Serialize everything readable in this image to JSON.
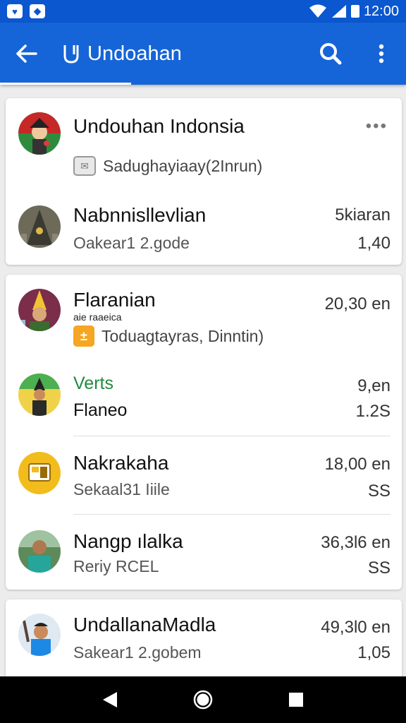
{
  "status_bar": {
    "time": "12:00"
  },
  "app_bar": {
    "title": "Undoahan"
  },
  "cards": [
    {
      "rows": [
        {
          "title": "Undouhan Indonsia",
          "chip": "Sadughayiaay(2Inrun)"
        },
        {
          "title": "Nabnnisllevlian",
          "subtitle": "Oakear1 2.gode",
          "right_top": "5kiaran",
          "right_bottom": "1,40"
        }
      ]
    },
    {
      "rows": [
        {
          "title": "Flaranian",
          "tiny": "aie raaeica",
          "chip": "Toduagtayras, Dinntin)",
          "right_top": "20,30 en"
        },
        {
          "title": "Verts",
          "subtitle": "Flaneo",
          "right_top": "9,en",
          "right_bottom": "1.2S"
        },
        {
          "title": "Nakrakaha",
          "subtitle": "Sekaal31 Iiile",
          "right_top": "18,00 en",
          "right_bottom": "SS"
        },
        {
          "title": "Nangp ılalka",
          "subtitle": "Reriy RCEL",
          "right_top": "36,3l6 en",
          "right_bottom": "SS"
        }
      ]
    },
    {
      "rows": [
        {
          "title": "UndallanaMadla",
          "subtitle": "Sakear1 2.gobem",
          "right_top": "49,3l0 en",
          "right_bottom": "1,05"
        }
      ]
    }
  ],
  "colors": {
    "primary": "#1565d8",
    "status_bar": "#0b57d0",
    "accent_green": "#1f8a3f",
    "accent_orange": "#f5a623"
  }
}
